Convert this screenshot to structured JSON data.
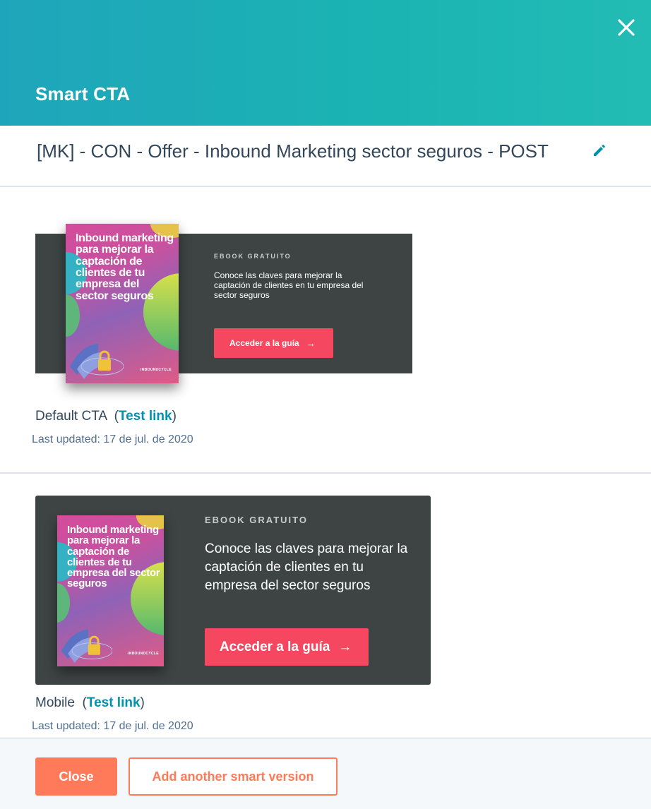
{
  "modal": {
    "title": "Smart CTA",
    "cta_name": "[MK] - CON - Offer - Inbound Marketing sector seguros - POST"
  },
  "versions": [
    {
      "label": "Default CTA",
      "test_link": "Test link",
      "last_updated": "Last updated: 17 de jul. de 2020",
      "banner": {
        "book_title": "Inbound marketing para mejorar la captación de clientes de tu empresa del sector seguros",
        "book_brand": "INBOUNDCYCLE",
        "eyebrow": "EBOOK GRATUITO",
        "pitch": "Conoce las claves para mejorar la captación de clientes en tu empresa del sector seguros",
        "button": "Acceder a la guía",
        "button_arrow": "→"
      }
    },
    {
      "label": "Mobile",
      "test_link": "Test link",
      "last_updated": "Last updated: 17 de jul. de 2020",
      "banner": {
        "book_title": "Inbound marketing para mejorar la captación de clientes de tu empresa del sector seguros",
        "book_brand": "INBOUNDCYCLE",
        "eyebrow": "EBOOK GRATUITO",
        "pitch": "Conoce las claves para mejorar la captación de clientes en tu empresa del sector seguros",
        "button": "Acceder a la guía",
        "button_arrow": "→"
      }
    }
  ],
  "footer": {
    "close_label": "Close",
    "add_label": "Add another smart version"
  },
  "colors": {
    "header_gradient_start": "#1fa5bb",
    "header_gradient_end": "#22bcb4",
    "banner_bg": "#3e4444",
    "cta_button": "#f5475f",
    "primary_orange": "#ff7a59",
    "link": "#0091ae"
  },
  "icons": {
    "close": "close-icon",
    "edit": "pencil-icon",
    "arrow": "arrow-right-icon",
    "lock": "lock-icon"
  }
}
